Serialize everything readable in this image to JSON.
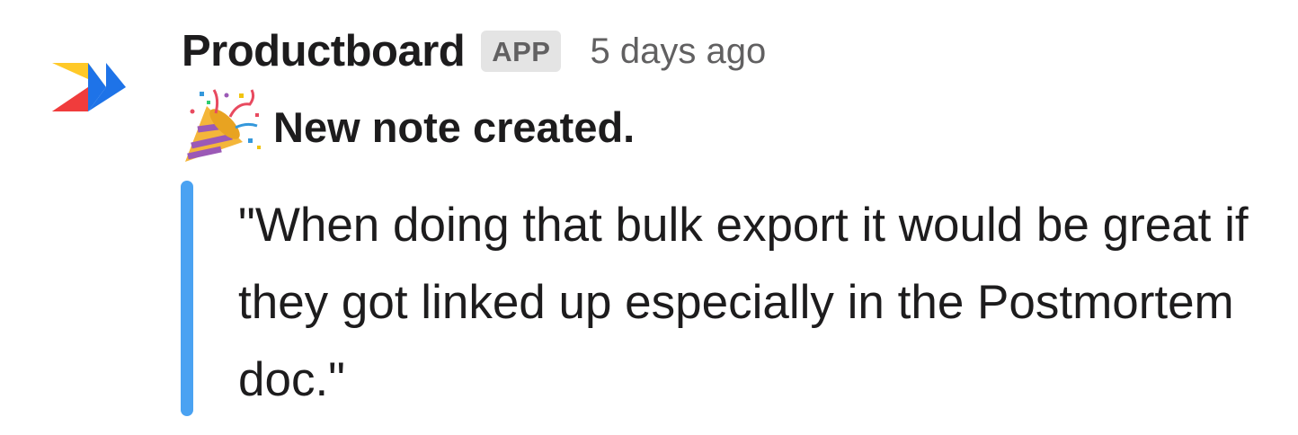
{
  "message": {
    "sender": "Productboard",
    "badge": "APP",
    "timestamp": "5 days ago",
    "title_emoji": "party-popper-icon",
    "title": "New note created.",
    "quote": "\"When doing that bulk export it would be great if they got linked up especially in the Postmortem doc.\""
  },
  "colors": {
    "quote_bar": "#4aa2f2",
    "logo_yellow": "#ffc928",
    "logo_blue": "#1e73e8",
    "logo_red": "#f03c3c"
  },
  "icons": {
    "avatar": "productboard-logo-icon"
  }
}
